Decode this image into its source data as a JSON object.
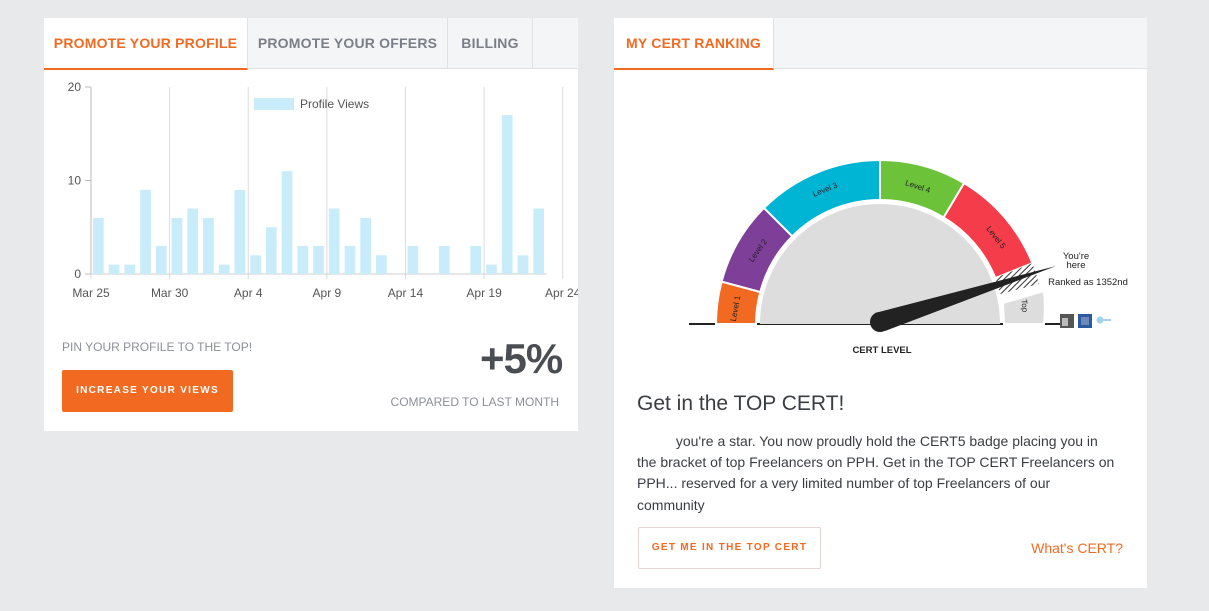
{
  "left_panel": {
    "tabs": [
      {
        "label": "PROMOTE YOUR PROFILE",
        "active": true
      },
      {
        "label": "PROMOTE YOUR OFFERS",
        "active": false
      },
      {
        "label": "BILLING",
        "active": false
      }
    ],
    "pin_note": "PIN YOUR PROFILE TO THE TOP!",
    "change_value": "+5%",
    "compare_note": "COMPARED TO LAST MONTH",
    "increase_button": "INCREASE YOUR VIEWS"
  },
  "chart_data": {
    "type": "bar",
    "legend": [
      "Profile Views"
    ],
    "series": [
      {
        "name": "Profile Views",
        "color": "#c9ecfb",
        "values": [
          6,
          1,
          1,
          9,
          3,
          6,
          7,
          6,
          1,
          9,
          2,
          5,
          11,
          3,
          3,
          7,
          3,
          6,
          2,
          0,
          3,
          0,
          3,
          0,
          3,
          1,
          17,
          2,
          7
        ]
      }
    ],
    "x_tick_labels": [
      "Mar 25",
      "Mar 30",
      "Apr 4",
      "Apr 9",
      "Apr 14",
      "Apr 19",
      "Apr 24"
    ],
    "y_ticks": [
      0,
      10,
      20
    ],
    "ylim": [
      0,
      20
    ],
    "grid": "vertical",
    "legend_position": "top"
  },
  "right_panel": {
    "tabs": [
      {
        "label": "MY CERT RANKING",
        "active": true
      }
    ],
    "gauge": {
      "segments": [
        {
          "label": "Level 1",
          "color": "#f26a21"
        },
        {
          "label": "Level 2",
          "color": "#7d3f98"
        },
        {
          "label": "Level 3",
          "color": "#00b4d4"
        },
        {
          "label": "Level 4",
          "color": "#6cc33a"
        },
        {
          "label": "Level 5",
          "color": "#f43c4a"
        },
        {
          "label": "Top",
          "color": "#dddddd"
        }
      ],
      "caption": "CERT LEVEL",
      "you_are_here_line1": "You're",
      "you_are_here_line2": "here",
      "ranked_text": "Ranked as 1352nd"
    },
    "heading": "Get in the TOP CERT!",
    "paragraph_lines": [
      "          you're a star. You now proudly hold the CERT5 badge placing you in",
      "the bracket of top Freelancers on PPH. Get in the TOP CERT Freelancers on",
      "PPH... reserved for a very limited number of top Freelancers of our",
      "community"
    ],
    "cta_button": "GET ME IN THE TOP CERT",
    "whats_cert_link": "What's CERT?"
  }
}
